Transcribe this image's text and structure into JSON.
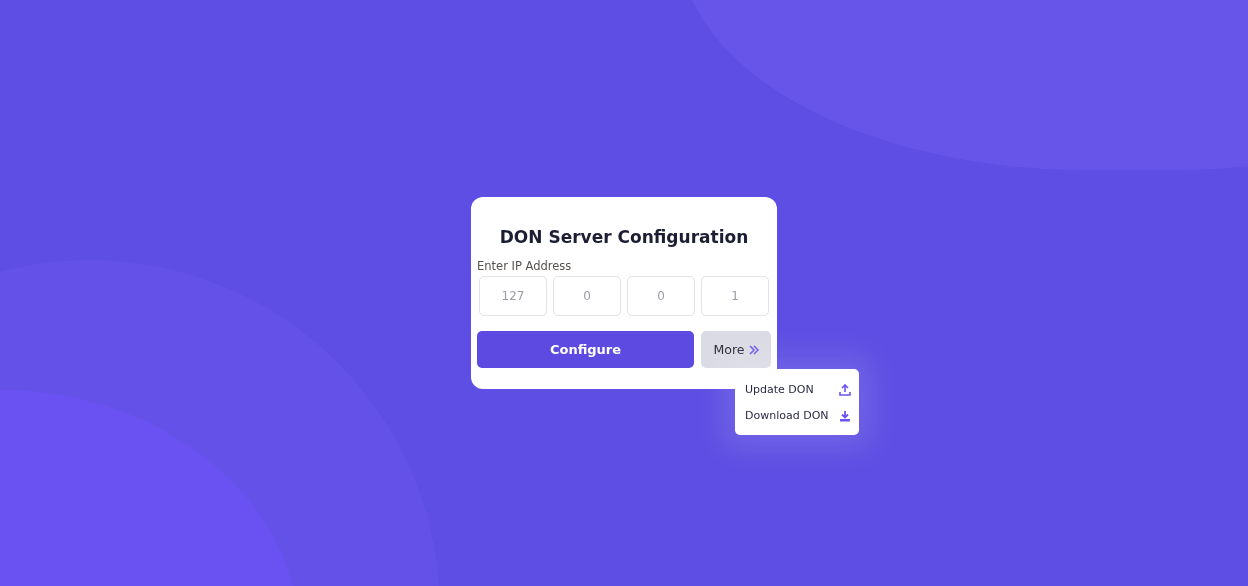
{
  "card": {
    "title": "DON Server Configuration",
    "ip_label": "Enter IP Address",
    "ip_fields": [
      {
        "placeholder": "127"
      },
      {
        "placeholder": "0"
      },
      {
        "placeholder": "0"
      },
      {
        "placeholder": "1"
      }
    ],
    "configure_button": "Configure",
    "more_button": "More"
  },
  "more_menu": {
    "expanded": true,
    "items": [
      {
        "label": "Update DON",
        "kind": "upload"
      },
      {
        "label": "Download DON",
        "kind": "download"
      }
    ]
  }
}
